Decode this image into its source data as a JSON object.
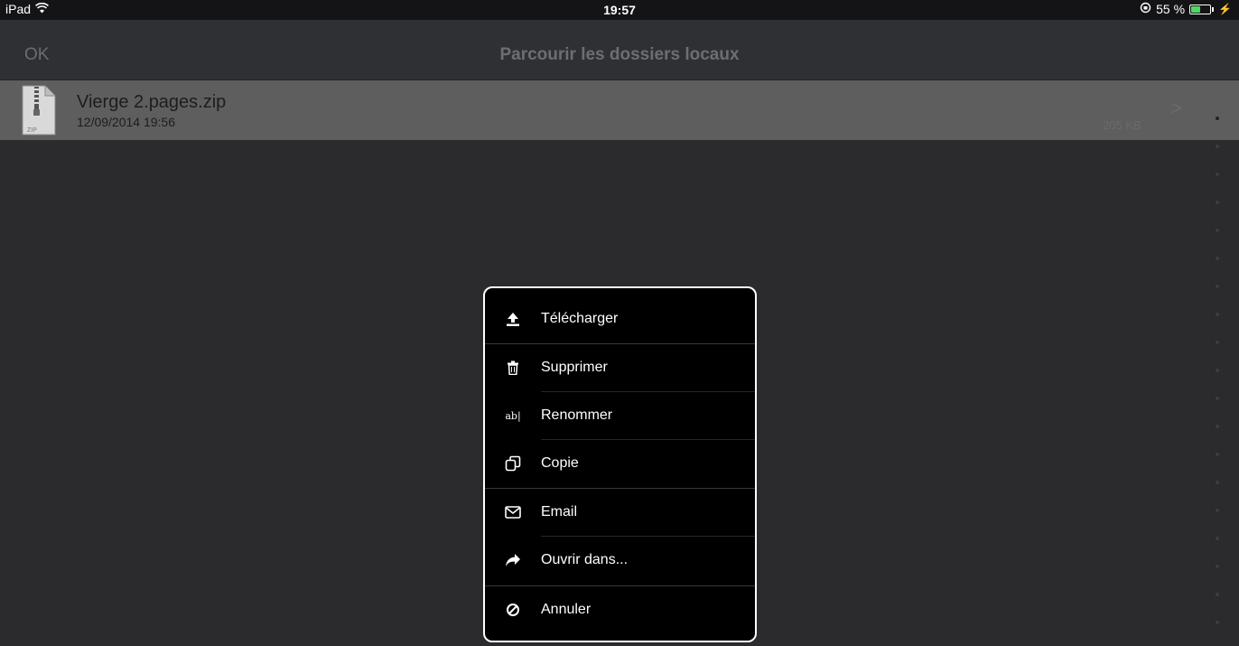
{
  "status_bar": {
    "device": "iPad",
    "time": "19:57",
    "battery_percent": "55 %",
    "battery_level": 0.55
  },
  "nav": {
    "ok_label": "OK",
    "title": "Parcourir les dossiers locaux"
  },
  "file": {
    "name": "Vierge 2.pages.zip",
    "date": "12/09/2014 19:56",
    "size": "205 KB",
    "icon": "zip-file-icon",
    "icon_label": "ZIP"
  },
  "action_sheet": {
    "items": [
      {
        "label": "Télécharger",
        "icon": "upload-icon"
      },
      {
        "label": "Supprimer",
        "icon": "trash-icon"
      },
      {
        "label": "Renommer",
        "icon": "rename-icon",
        "icon_text": "ab|"
      },
      {
        "label": "Copie",
        "icon": "copy-icon"
      },
      {
        "label": "Email",
        "icon": "envelope-icon"
      },
      {
        "label": "Ouvrir dans...",
        "icon": "share-arrow-icon"
      },
      {
        "label": "Annuler",
        "icon": "cancel-icon"
      }
    ]
  },
  "colors": {
    "background": "#2b2b2d",
    "highlight_row": "#5e5e5f",
    "sheet_background": "#000000",
    "battery": "#4cd964"
  }
}
